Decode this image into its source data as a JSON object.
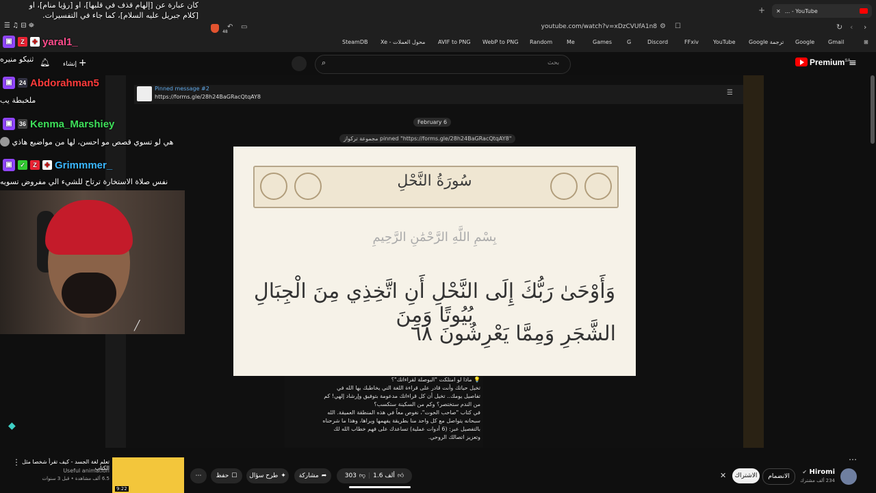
{
  "browser": {
    "tab_title": "... - YouTube",
    "url": "youtube.com/watch?v=xDzCVUfA1n8",
    "bookmarks": [
      {
        "label": "SteamDB"
      },
      {
        "label": "Xe - محول العملات"
      },
      {
        "label": "AVIF to PNG"
      },
      {
        "label": "WebP to PNG"
      },
      {
        "label": "Random"
      },
      {
        "label": "Me"
      },
      {
        "label": "Games"
      },
      {
        "label": "G"
      },
      {
        "label": "Discord"
      },
      {
        "label": "FFxiv"
      },
      {
        "label": "YouTube"
      },
      {
        "label": "Google ترجمة"
      },
      {
        "label": "Google"
      },
      {
        "label": "Gmail"
      }
    ],
    "shield_count": "48"
  },
  "youtube": {
    "logo": "Premium",
    "logo_sup": "SA",
    "search_placeholder": "بحث",
    "create_label": "إنشاء"
  },
  "overlay": {
    "title_line1": "كان عبارة عن [إلهام قذف في قلبها]، او [رؤيا منام]، او",
    "title_line2": "[كلام جبريل عليه السلام]، كما جاء في التفسيرات.",
    "chat": [
      {
        "user": "yaral1_",
        "color": "#ff4d8d",
        "message": "ثنيكو منيره"
      },
      {
        "user": "Abdorahman5",
        "color": "#ff3b3b",
        "message": "ملخبطة يب"
      },
      {
        "user": "Kenma_Marshiey",
        "color": "#3ee05a",
        "message": "هي لو تسوي قصص مو احسن، لها من مواضيع هاذي"
      },
      {
        "user": "Grimmmer_",
        "color": "#3bb7ff",
        "message": "نفس صلاة الاستخارة ترتاح للشيء الي مفروض تسويه"
      }
    ]
  },
  "video": {
    "pinned_title": "Pinned message #2",
    "pinned_url": "https://forms.gle/28h24BaGRacQtqAY8",
    "date_chip": "February 6",
    "pinned_notice": "مجموعة تركواز pinned \"https://forms.gle/28h24BaGRacQtqAY8\"",
    "surah_title": "سُورَةُ النَّحْلِ",
    "basmala": "بِسْمِ اللَّهِ الرَّحْمَٰنِ الرَّحِيمِ",
    "verse_line1": "وَأَوْحَىٰ رَبُّكَ إِلَى النَّحْلِ أَنِ اتَّخِذِي مِنَ الْجِبَالِ بُيُوتًا وَمِنَ",
    "verse_line2": "الشَّجَرِ وَمِمَّا يَعْرِشُونَ ٦٨",
    "description": [
      "💡 ماذا لو امتلكت \"البوصلة لقراءاتك\"؟",
      "تخيل حياتك وأنت قادر على قراءة اللغة التي يخاطبك بها الله في",
      "تفاصيل يومك.. تخيل أن كل قراءاتك مدعومة بتوفيق وإرشاد إلهي! كم",
      "من الندم ستختصر؟ وكم من السكينة ستكسب؟",
      "في كتاب \"صاحب الحوت\"، نغوص معاً في هذه المنطقة العميقة. الله",
      "سبحانه يتواصل مع كل واحد منا بطريقة يفهمها ويراها، وهذا ما شرحناه",
      "بالتفصيل عبر: (6 أدوات عملية) تساعدك على فهم خطاب الله لك",
      "وتعزيز اتصالك الروحي."
    ]
  },
  "bottom": {
    "suggestion_title": "تعلم لغة الجسد - كيف تقرأ شخصا مثل الكتاب",
    "suggestion_channel": "Useful animation",
    "suggestion_meta": "6.5 ألف مشاهدة • قبل 3 سنوات",
    "suggestion_duration": "9:22",
    "save_label": "حفظ",
    "ask_label": "طرح سؤال",
    "share_label": "مشاركة",
    "dislike_count": "303",
    "like_count": "1.6 ألف",
    "subscribe_label": "الاشتراك",
    "join_label": "الانضمام",
    "channel_name": "Hiromi",
    "channel_subs": "234 ألف مشترك"
  }
}
